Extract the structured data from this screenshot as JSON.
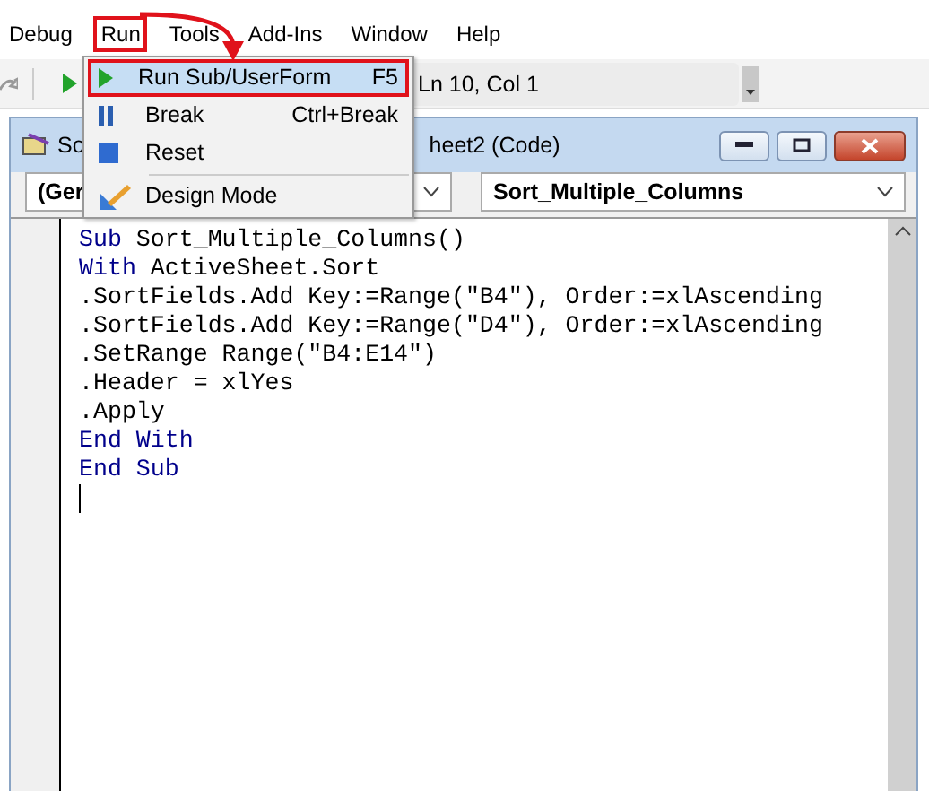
{
  "menubar": [
    {
      "label": "Debug",
      "selected": false
    },
    {
      "label": "Run",
      "selected": true
    },
    {
      "label": "Tools",
      "selected": false
    },
    {
      "label": "Add-Ins",
      "selected": false
    },
    {
      "label": "Window",
      "selected": false
    },
    {
      "label": "Help",
      "selected": false
    }
  ],
  "run_menu": {
    "items": [
      {
        "kind": "run",
        "label": "Run Sub/UserForm",
        "shortcut": "F5",
        "highlighted": true
      },
      {
        "kind": "break",
        "label": "Break",
        "shortcut": "Ctrl+Break",
        "highlighted": false
      },
      {
        "kind": "reset",
        "label": "Reset",
        "highlighted": false
      },
      {
        "kind": "design",
        "label": "Design Mode",
        "highlighted": false
      }
    ]
  },
  "toolbar": {
    "position": "Ln 10, Col 1"
  },
  "code_window": {
    "title_start": "So",
    "title_end": "heet2 (Code)",
    "object_combo": "(Ger",
    "procedure_combo": "Sort_Multiple_Columns",
    "lines": [
      [
        {
          "text": "Sub",
          "keyword": true
        },
        {
          "text": " Sort_Multiple_Columns()",
          "keyword": false
        }
      ],
      [
        {
          "text": "With",
          "keyword": true
        },
        {
          "text": " ActiveSheet.Sort",
          "keyword": false
        }
      ],
      [
        {
          "text": ".SortFields.Add Key:=Range(\"B4\"), Order:=xlAscending",
          "keyword": false
        }
      ],
      [
        {
          "text": ".SortFields.Add Key:=Range(\"D4\"), Order:=xlAscending",
          "keyword": false
        }
      ],
      [
        {
          "text": ".SetRange Range(\"B4:E14\")",
          "keyword": false
        }
      ],
      [
        {
          "text": ".Header = xlYes",
          "keyword": false
        }
      ],
      [
        {
          "text": ".Apply",
          "keyword": false
        }
      ],
      [
        {
          "text": "End With",
          "keyword": true
        }
      ],
      [
        {
          "text": "End Sub",
          "keyword": true
        }
      ]
    ]
  }
}
